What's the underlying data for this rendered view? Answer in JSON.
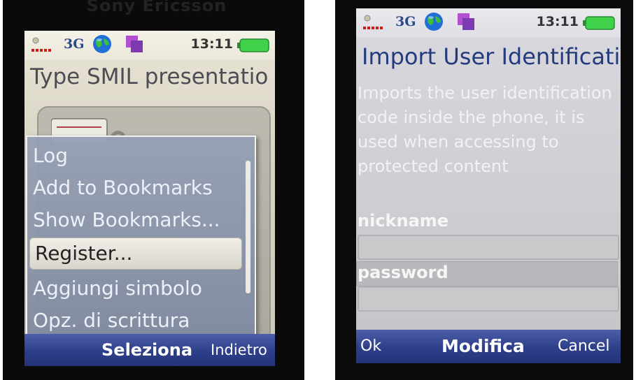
{
  "left_phone": {
    "brand": "Sony Ericsson",
    "status": {
      "network": "3G",
      "time": "13:11"
    },
    "title": "Type SMIL presentatio",
    "menu": {
      "items": [
        {
          "label": "Log",
          "selected": false
        },
        {
          "label": "Add to Bookmarks",
          "selected": false
        },
        {
          "label": "Show Bookmarks...",
          "selected": false
        },
        {
          "label": "Register...",
          "selected": true
        },
        {
          "label": "Aggiungi simbolo",
          "selected": false
        },
        {
          "label": "Opz. di scrittura",
          "selected": false
        }
      ]
    },
    "softkeys": {
      "center": "Seleziona",
      "right": "Indietro"
    }
  },
  "right_phone": {
    "status": {
      "network": "3G",
      "time": "13:11"
    },
    "title": "Import User Identificati",
    "description": "Imports the user identification code inside the phone, it is used when accessing to protected content",
    "fields": {
      "nickname_label": "nickname",
      "nickname_value": "",
      "password_label": "password",
      "password_value": ""
    },
    "softkeys": {
      "left": "Ok",
      "center": "Modifica",
      "right": "Cancel"
    }
  },
  "colors": {
    "softkey_bar": "#2e3f8a",
    "title_blue": "#233a7c",
    "menu_popup": "#8f9ab2",
    "battery_green": "#3fd24a"
  }
}
